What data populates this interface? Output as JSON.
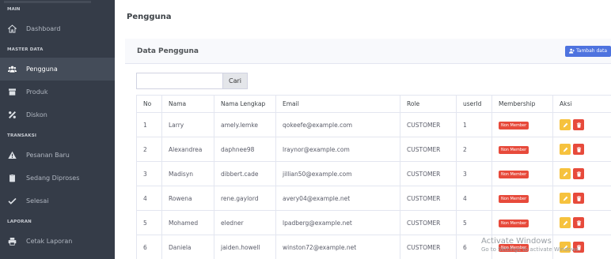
{
  "sidebar": {
    "header": "MAIN",
    "dashboard": "Dashboard",
    "section_master": "MASTER DATA",
    "pengguna": "Pengguna",
    "produk": "Produk",
    "diskon": "Diskon",
    "section_transaksi": "TRANSAKSI",
    "pesanan_baru": "Pesanan Baru",
    "sedang_diproses": "Sedang Diproses",
    "selesai": "Selesai",
    "section_laporan": "LAPORAN",
    "cetak_laporan": "Cetak Laporan"
  },
  "topbar": {
    "title": "Pengguna"
  },
  "card": {
    "title": "Data Pengguna",
    "add_label": "Tambah data"
  },
  "search": {
    "value": "",
    "placeholder": "",
    "button": "Cari"
  },
  "table": {
    "headers": [
      "No",
      "Nama",
      "Nama Lengkap",
      "Email",
      "Role",
      "userId",
      "Membership",
      "Aksi"
    ],
    "rows": [
      [
        "1",
        "Larry",
        "amely.lemke",
        "qokeefe@example.com",
        "CUSTOMER",
        "1",
        "Non Member"
      ],
      [
        "2",
        "Alexandrea",
        "daphnee98",
        "lraynor@example.com",
        "CUSTOMER",
        "2",
        "Non Member"
      ],
      [
        "3",
        "Madisyn",
        "dibbert.cade",
        "jillian50@example.com",
        "CUSTOMER",
        "3",
        "Non Member"
      ],
      [
        "4",
        "Rowena",
        "rene.gaylord",
        "avery04@example.net",
        "CUSTOMER",
        "4",
        "Non Member"
      ],
      [
        "5",
        "Mohamed",
        "eledner",
        "lpadberg@example.net",
        "CUSTOMER",
        "5",
        "Non Member"
      ],
      [
        "6",
        "Daniela",
        "jaiden.howell",
        "winston72@example.net",
        "CUSTOMER",
        "6",
        "Non Member"
      ]
    ]
  },
  "watermark": {
    "line1": "Activate Windows",
    "line2": "Go to Settings to activate Windows."
  },
  "colors": {
    "sidebar_bg": "#353c48",
    "primary": "#4e73df",
    "warning": "#f6c23e",
    "danger": "#e74a3b"
  },
  "icons": {
    "dashboard": "home-icon",
    "pengguna": "users-icon",
    "produk": "box-icon",
    "diskon": "percent-icon",
    "pesanan_baru": "warning-icon",
    "sedang_diproses": "clipboard-icon",
    "selesai": "check-icon",
    "cetak_laporan": "print-icon",
    "add": "user-plus-icon",
    "edit": "edit-icon",
    "delete": "trash-icon"
  }
}
